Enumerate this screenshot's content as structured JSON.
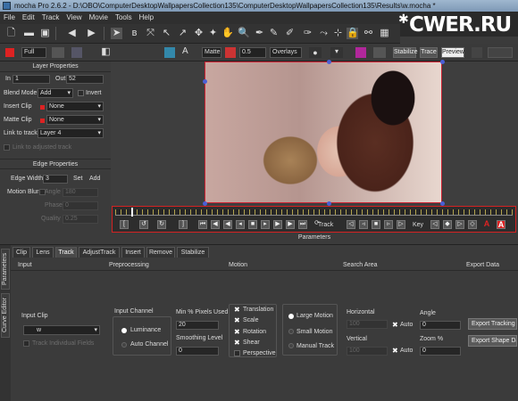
{
  "window": {
    "title": "mocha Pro 2.6.2 - D:\\OBO\\ComputerDesktopWallpapersCollection135\\ComputerDesktopWallpapersCollection135\\Results\\w.mocha *"
  },
  "menu": [
    "File",
    "Edit",
    "Track",
    "View",
    "Movie",
    "Tools",
    "Help"
  ],
  "watermark": {
    "text": "CWER.RU"
  },
  "toolbar2": {
    "quality": "Full",
    "matte": "Matte",
    "opacity": "0.5",
    "overlays": "Overlays",
    "stabilize": "Stabilize",
    "trace": "Trace",
    "preview": "Preview"
  },
  "layer_properties": {
    "header": "Layer Properties",
    "in_label": "In",
    "in_value": "1",
    "out_label": "Out",
    "out_value": "52",
    "blend_mode_label": "Blend Mode",
    "blend_mode": "Add",
    "invert_label": "Invert",
    "insert_clip_label": "Insert Clip",
    "insert_clip": "None",
    "matte_clip_label": "Matte Clip",
    "matte_clip": "None",
    "link_label": "Link to track",
    "link_value": "Layer 4",
    "link_adjusted": "Link to adjusted track"
  },
  "edge_properties": {
    "header": "Edge Properties",
    "edge_width_label": "Edge Width",
    "edge_width": "3",
    "set_label": "Set",
    "add_label": "Add",
    "motion_blur_label": "Motion Blur",
    "angle_label": "Angle",
    "angle": "180",
    "phase_label": "Phase",
    "phase": "0",
    "quality_label": "Quality",
    "quality": "0.25"
  },
  "timeline": {
    "track_label": "Track",
    "key_label": "Key",
    "playhead_fraction": 0.04
  },
  "parameters_label": "Parameters",
  "side_tabs": [
    "Parameters",
    "Curve Editor"
  ],
  "tabs": [
    "Clip",
    "Lens",
    "Track",
    "AdjustTrack",
    "Insert",
    "Remove",
    "Stabilize"
  ],
  "active_tab": "Track",
  "columns": [
    "Input",
    "Preprocessing",
    "Motion",
    "Search Area",
    "Export Data"
  ],
  "input": {
    "clip_label": "Input Clip",
    "clip_value": "w",
    "track_fields": "Track Individual Fields"
  },
  "preprocessing": {
    "channel_label": "Input Channel",
    "luminance": "Luminance",
    "auto_channel": "Auto Channel",
    "min_pixels_label": "Min % Pixels Used",
    "min_pixels": "20",
    "smoothing_label": "Smoothing Level",
    "smoothing": "0"
  },
  "motion": {
    "translation": "Translation",
    "scale": "Scale",
    "rotation": "Rotation",
    "shear": "Shear",
    "perspective": "Perspective",
    "large": "Large Motion",
    "small": "Small Motion",
    "manual": "Manual Track"
  },
  "search_area": {
    "horizontal_label": "Horizontal",
    "horizontal": "100",
    "vertical_label": "Vertical",
    "vertical": "100",
    "auto": "Auto",
    "angle_label": "Angle",
    "angle": "0",
    "zoom_label": "Zoom %",
    "zoom": "0"
  },
  "export": {
    "tracking": "Export Tracking Data...",
    "shape": "Export Shape Data..."
  },
  "colors": {
    "accent_red": "#d42222",
    "handle_blue": "#4a5fd6"
  }
}
